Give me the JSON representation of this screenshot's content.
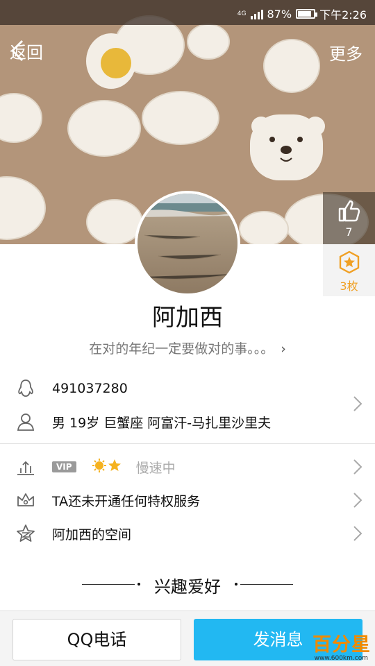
{
  "status": {
    "network": "4G",
    "battery": "87%",
    "time": "下午2:26"
  },
  "nav": {
    "back_label": "返回",
    "more_label": "更多"
  },
  "likes": {
    "count": "7"
  },
  "medals": {
    "count": "3枚"
  },
  "profile": {
    "nickname": "阿加西",
    "signature": "在对的年纪一定要做对的事。。。",
    "qq_number": "491037280",
    "details": "男  19岁  巨蟹座  阿富汗-马扎里沙里夫"
  },
  "vip": {
    "badge": "VIP",
    "status": "慢速中"
  },
  "privilege": {
    "label": "TA还未开通任何特权服务"
  },
  "space": {
    "label": "阿加西的空间"
  },
  "section": {
    "title": "兴趣爱好"
  },
  "buttons": {
    "call": "QQ电话",
    "message": "发消息"
  },
  "watermark": {
    "text": "百分星",
    "url": "www.600km.com"
  },
  "colors": {
    "accent": "#22b8f2",
    "cover": "#b3957a",
    "medal": "#f0a024"
  }
}
